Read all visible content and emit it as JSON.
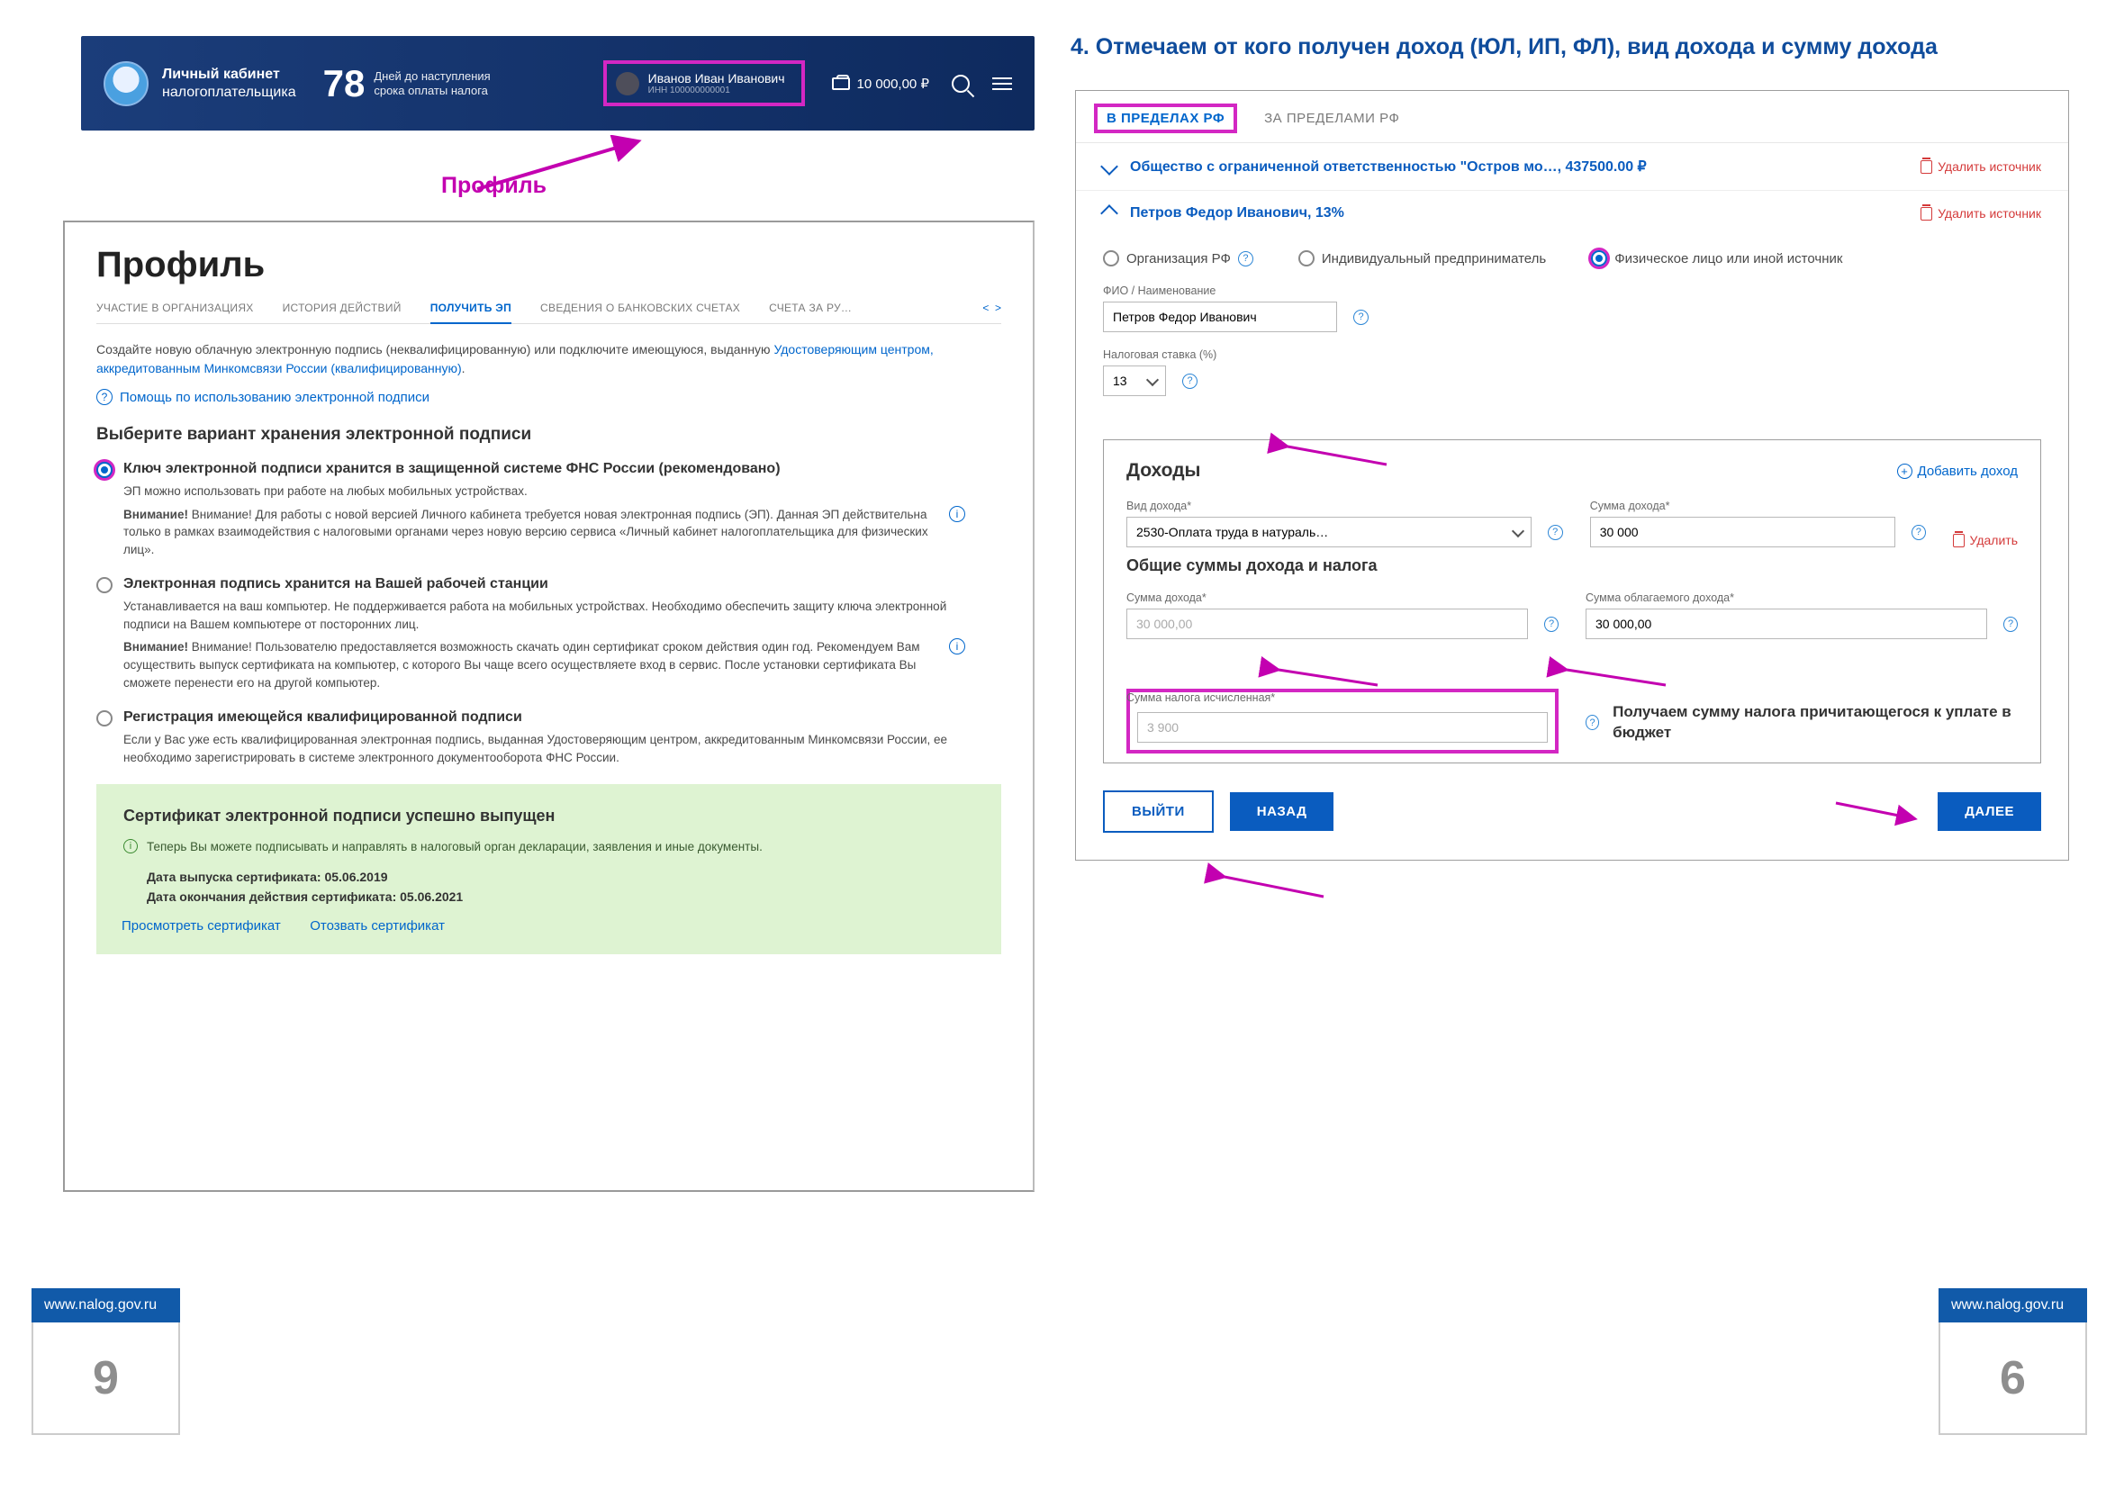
{
  "left": {
    "header": {
      "app_line1": "Личный кабинет",
      "app_line2": "налогоплательщика",
      "days_num": "78",
      "days_txt1": "Дней до наступления",
      "days_txt2": "срока оплаты налога",
      "user_name": "Иванов Иван Иванович",
      "user_inn": "ИНН 100000000001",
      "amount": "10 000,00 ₽"
    },
    "profile_label": "Профиль",
    "panel": {
      "h1": "Профиль",
      "tabs": {
        "t1": "УЧАСТИЕ В ОРГАНИЗАЦИЯХ",
        "t2": "ИСТОРИЯ ДЕЙСТВИЙ",
        "t3": "ПОЛУЧИТЬ ЭП",
        "t4": "СВЕДЕНИЯ О БАНКОВСКИХ СЧЕТАХ",
        "t5": "СЧЕТА ЗА РУ…"
      },
      "intro_a": "Создайте новую облачную электронную подпись (неквалифицированную) или подключите имеющуюся, выданную ",
      "intro_link": "Удостоверяющим центром, аккредитованным Минкомсвязи России (квалифицированную)",
      "intro_b": ".",
      "help": "Помощь по использованию электронной подписи",
      "choose": "Выберите вариант хранения электронной подписи",
      "opt1": {
        "title": "Ключ электронной подписи хранится в защищенной системе ФНС России (рекомендовано)",
        "p1": "ЭП можно использовать при работе на любых мобильных устройствах.",
        "p2": "Внимание! Для работы с новой версией Личного кабинета требуется новая электронная подпись (ЭП). Данная ЭП действительна только в рамках взаимодействия с налоговыми органами через новую версию сервиса «Личный кабинет налогоплательщика для физических лиц»."
      },
      "opt2": {
        "title": "Электронная подпись хранится на Вашей рабочей станции",
        "p1": "Устанавливается на ваш компьютер. Не поддерживается работа на мобильных устройствах. Необходимо обеспечить защиту ключа электронной подписи на Вашем компьютере от посторонних лиц.",
        "p2": "Внимание! Пользователю предоставляется возможность скачать один сертификат сроком действия один год. Рекомендуем Вам осуществить выпуск сертификата на компьютер, с которого Вы чаще всего осуществляете вход в сервис. После установки сертификата Вы сможете перенести его на другой компьютер."
      },
      "opt3": {
        "title": "Регистрация имеющейся квалифицированной подписи",
        "p1": "Если у Вас уже есть квалифицированная электронная подпись, выданная Удостоверяющим центром, аккредитованным Минкомсвязи России, ее необходимо зарегистрировать в системе электронного документооборота ФНС России."
      },
      "cert": {
        "h": "Сертификат электронной подписи успешно выпущен",
        "msg": "Теперь Вы можете подписывать и направлять в налоговый орган декларации, заявления и иные документы.",
        "d1": "Дата выпуска сертификата: 05.06.2019",
        "d2": "Дата окончания действия сертификата: 05.06.2021",
        "link1": "Просмотреть сертификат",
        "link2": "Отозвать сертификат"
      }
    },
    "footer": {
      "url": "www.nalog.gov.ru",
      "num": "9"
    }
  },
  "right": {
    "step": "4. Отмечаем от кого получен доход (ЮЛ, ИП, ФЛ), вид дохода и сумму дохода",
    "tabs": {
      "t1": "В ПРЕДЕЛАХ РФ",
      "t2": "ЗА ПРЕДЕЛАМИ РФ"
    },
    "src1": "Общество с ограниченной ответственностью \"Остров мо…, 437500.00 ₽",
    "src2": "Петров Федор Иванович, 13%",
    "delete_source": "Удалить источник",
    "radios": {
      "r1": "Организация РФ",
      "r2": "Индивидуальный предприниматель",
      "r3": "Физическое лицо или иной источник"
    },
    "fio_label": "ФИО / Наименование",
    "fio_value": "Петров Федор Иванович",
    "rate_label": "Налоговая ставка (%)",
    "rate_value": "13",
    "income_h": "Доходы",
    "add_income": "Добавить доход",
    "income_type_label": "Вид дохода*",
    "income_type_value": "2530-Оплата труда в натураль…",
    "income_sum_label": "Сумма дохода*",
    "income_sum_value": "30 000",
    "delete_income": "Удалить",
    "totals_h": "Общие суммы дохода и налога",
    "total_income_label": "Сумма дохода*",
    "total_income_value": "30 000,00",
    "taxable_label": "Сумма облагаемого дохода*",
    "taxable_value": "30 000,00",
    "tax_calc_label": "Сумма налога исчисленная*",
    "tax_calc_value": "3 900",
    "note": "Получаем сумму налога причитающегося к уплате в бюджет",
    "btn_exit": "ВЫЙТИ",
    "btn_back": "НАЗАД",
    "btn_next": "ДАЛЕЕ",
    "footer": {
      "url": "www.nalog.gov.ru",
      "num": "6"
    }
  }
}
